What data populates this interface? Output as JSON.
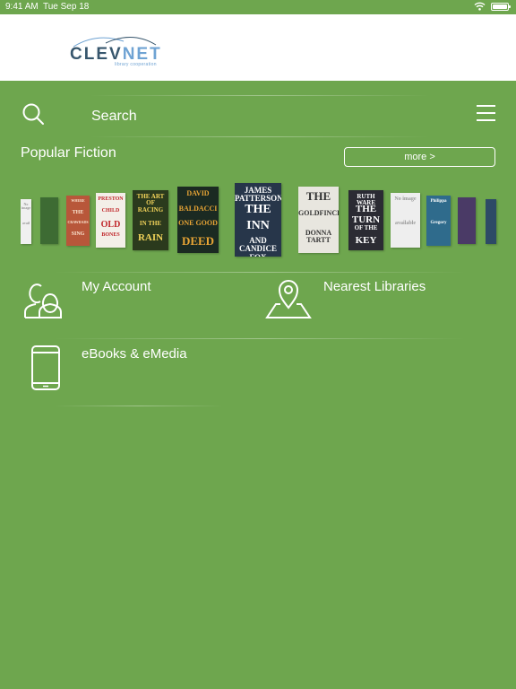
{
  "status_bar": {
    "time": "9:41 AM",
    "date": "Tue Sep 18",
    "battery_level": 1.0
  },
  "header": {
    "logo": {
      "text_main": "CLEV",
      "text_accent": "NET",
      "subtitle": "library cooperation"
    },
    "icons": [
      "wifi-icon",
      "battery-icon"
    ]
  },
  "search": {
    "label": "Search",
    "icon": "search-icon"
  },
  "menu": {
    "icon": "hamburger-menu-icon"
  },
  "popular": {
    "title": "Popular Fiction",
    "more_label": "more >",
    "books": [
      {
        "lines": [
          "No image",
          "avail"
        ],
        "bg": "#f0f0f0",
        "fg": "#999999"
      },
      {
        "lines": [],
        "bg": "#3d6b33",
        "fg": "#ffffff"
      },
      {
        "lines": [
          "WHERE",
          "THE",
          "CRAWDADS",
          "SING"
        ],
        "bg": "#b8573a",
        "fg": "#fbe6d2"
      },
      {
        "lines": [
          "PRESTON",
          "CHILD",
          "OLD",
          "BONES"
        ],
        "bg": "#f3efe8",
        "fg": "#c0262a"
      },
      {
        "lines": [
          "THE ART OF",
          "RACING",
          "IN THE",
          "RAIN"
        ],
        "bg": "#2b3a1d",
        "fg": "#f2d35a"
      },
      {
        "lines": [
          "DAVID",
          "BALDACCI",
          "ONE GOOD",
          "DEED"
        ],
        "bg": "#1b2a22",
        "fg": "#e9a535"
      },
      {
        "lines": [
          "JAMES PATTERSON",
          "THE",
          "INN",
          "AND CANDICE FOX"
        ],
        "bg": "#27364a",
        "fg": "#ffffff"
      },
      {
        "lines": [
          "THE",
          "GOLDFINCH",
          "DONNA TARTT"
        ],
        "bg": "#e8e6df",
        "fg": "#333333"
      },
      {
        "lines": [
          "RUTH WARE",
          "THE",
          "TURN",
          "OF THE",
          "KEY"
        ],
        "bg": "#2b2b33",
        "fg": "#ffffff"
      },
      {
        "lines": [
          "No image",
          "available"
        ],
        "bg": "#eeeeee",
        "fg": "#999999"
      },
      {
        "lines": [
          "Philippa",
          "Gregory"
        ],
        "bg": "#2f6b8c",
        "fg": "#ffffff"
      },
      {
        "lines": [],
        "bg": "#4a3a66",
        "fg": "#ffffff"
      },
      {
        "lines": [],
        "bg": "#2d4a66",
        "fg": "#ffffff"
      }
    ]
  },
  "nav": {
    "my_account": "My Account",
    "nearest_libraries": "Nearest Libraries",
    "ebooks": "eBooks & eMedia"
  },
  "colors": {
    "background": "#6ea64e",
    "header_bg": "#ffffff",
    "text": "#ffffff",
    "logo_dark": "#37566d",
    "logo_light": "#6fa3d3"
  }
}
